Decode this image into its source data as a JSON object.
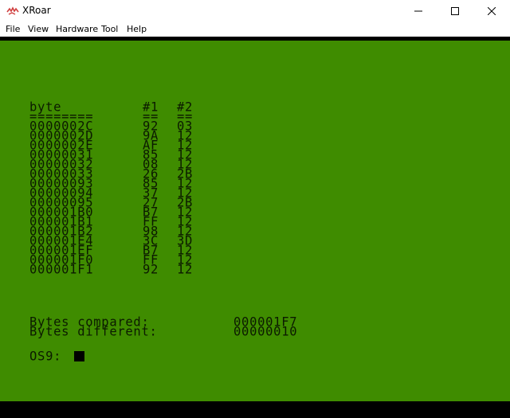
{
  "window": {
    "title": "XRoar",
    "icon": "xroar-icon",
    "controls": [
      "minimize-icon",
      "maximize-icon",
      "close-icon"
    ]
  },
  "menu": {
    "items": [
      "File",
      "View",
      "Hardware",
      "Tool",
      "Help"
    ]
  },
  "colors": {
    "screen_bg": "#3f8c00",
    "screen_text": "#0b1a00",
    "border": "#000000"
  },
  "screen": {
    "header": {
      "col1": "byte",
      "col2": "#1",
      "col3": "#2"
    },
    "rule": {
      "col1": "========",
      "col2": "==",
      "col3": "=="
    },
    "rows": [
      {
        "byte": "0000002C",
        "v1": "92",
        "v2": "03"
      },
      {
        "byte": "0000002D",
        "v1": "9A",
        "v2": "12"
      },
      {
        "byte": "0000002E",
        "v1": "AF",
        "v2": "12"
      },
      {
        "byte": "00000031",
        "v1": "85",
        "v2": "12"
      },
      {
        "byte": "00000032",
        "v1": "08",
        "v2": "12"
      },
      {
        "byte": "00000033",
        "v1": "26",
        "v2": "2B"
      },
      {
        "byte": "00000093",
        "v1": "85",
        "v2": "12"
      },
      {
        "byte": "00000094",
        "v1": "37",
        "v2": "12"
      },
      {
        "byte": "00000095",
        "v1": "27",
        "v2": "2B"
      },
      {
        "byte": "000001B0",
        "v1": "B7",
        "v2": "12"
      },
      {
        "byte": "000001B1",
        "v1": "FF",
        "v2": "12"
      },
      {
        "byte": "000001B2",
        "v1": "98",
        "v2": "12"
      },
      {
        "byte": "000001E4",
        "v1": "3C",
        "v2": "3D"
      },
      {
        "byte": "000001EF",
        "v1": "B7",
        "v2": "12"
      },
      {
        "byte": "000001F0",
        "v1": "FF",
        "v2": "12"
      },
      {
        "byte": "000001F1",
        "v1": "92",
        "v2": "12"
      }
    ],
    "summary": [
      {
        "label": "Bytes compared:",
        "value": "000001F7"
      },
      {
        "label": "Bytes different:",
        "value": "00000010"
      }
    ],
    "prompt": "OS9:"
  }
}
